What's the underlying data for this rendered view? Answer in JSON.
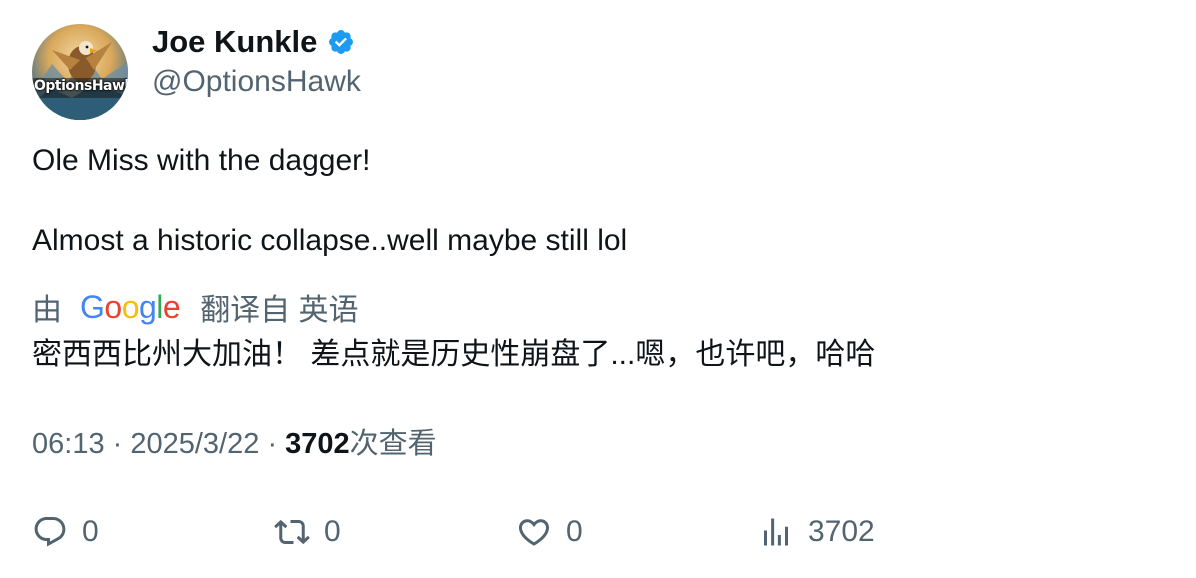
{
  "author": {
    "display_name": "Joe Kunkle",
    "handle": "@OptionsHawk",
    "verified": true,
    "avatar_text": "OptionsHawk",
    "verified_color": "#1d9bf0"
  },
  "tweet": {
    "lines": [
      "Ole Miss with the dagger!",
      "Almost a historic collapse..well maybe still lol"
    ]
  },
  "translation": {
    "prefix": "由",
    "provider": "Google",
    "suffix": "翻译自 英语",
    "text": "密西西比州大加油！ 差点就是历史性崩盘了...嗯，也许吧，哈哈"
  },
  "meta": {
    "time": "06:13",
    "separator": "·",
    "date": "2025/3/22",
    "views_count": "3702",
    "views_label": "次查看"
  },
  "actions": {
    "reply_count": "0",
    "retweet_count": "0",
    "like_count": "0",
    "views_count": "3702"
  },
  "icons": {
    "reply": "reply-icon",
    "retweet": "retweet-icon",
    "like": "heart-icon",
    "views": "analytics-icon",
    "verified": "verified-badge-icon"
  },
  "colors": {
    "text_primary": "#0f1419",
    "text_secondary": "#536471",
    "google_blue": "#4285F4",
    "google_red": "#EA4335",
    "google_yellow": "#FBBC05",
    "google_green": "#34A853"
  }
}
